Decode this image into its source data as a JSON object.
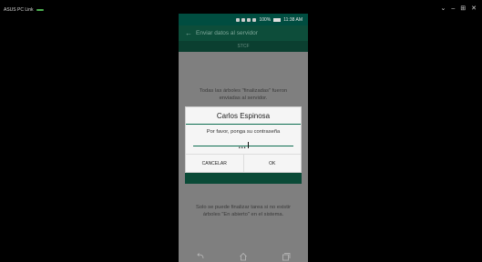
{
  "window": {
    "title": "ASUS PC Link",
    "controls": [
      "⌄",
      "–",
      "⊞",
      "✕"
    ]
  },
  "statusbar": {
    "battery": "100%",
    "time": "11:38 AM"
  },
  "toolbar": {
    "title": "Enviar datos al servidor",
    "subtitle": "STCF"
  },
  "background": {
    "top_text_line1": "Todas las árboles \"finalizadas\" fueron",
    "top_text_line2": "enviadas al servidor.",
    "bottom_text_line1": "Solo se puede finalizar tarea si no existir",
    "bottom_text_line2": "árboles \"En abierto\" en el sistema."
  },
  "dialog": {
    "title": "Carlos Espinosa",
    "message": "Por favor, ponga su contraseña",
    "password_mask": "•••",
    "cancel_label": "CANCELAR",
    "ok_label": "OK"
  },
  "colors": {
    "accent": "#0d6e50",
    "toolbar": "#0d4d3a",
    "overlay": "#7f7f7f"
  }
}
